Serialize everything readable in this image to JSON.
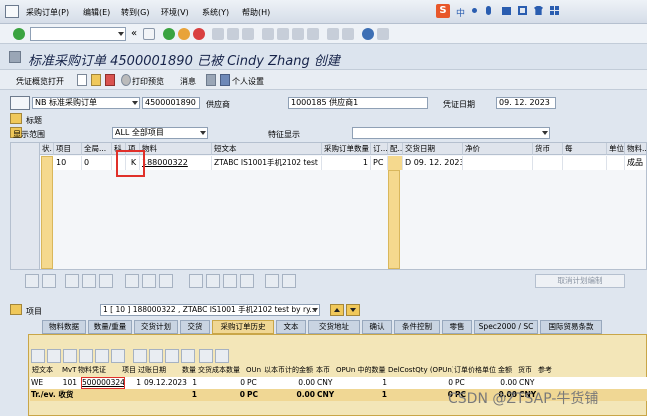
{
  "menubar": {
    "items": [
      "采购订单(P)",
      "编辑(E)",
      "转到(G)",
      "环境(V)",
      "系统(Y)",
      "帮助(H)"
    ],
    "ime_logo": "S",
    "ime_label": "中"
  },
  "toolbar": {
    "command_field": "",
    "nav_arrows": "«"
  },
  "title": "标准采购订单 4500001890 已被 Cindy Zhang 创建",
  "app_toolbar": {
    "overview_label": "凭证概览打开",
    "print_preview_label": "打印预览",
    "messages_label": "消息",
    "personal_settings_label": "个人设置"
  },
  "header": {
    "doc_type_value": "NB 标准采购订单",
    "po_number": "4500001890",
    "vendor_label": "供应商",
    "vendor_value": "1000185 供应商1",
    "doc_date_label": "凭证日期",
    "doc_date_value": "09. 12. 2023",
    "header_label": "标题",
    "display_range_label": "显示范围",
    "display_range_value": "ALL 全部项目",
    "feature_display_label": "特征显示",
    "feature_display_value": ""
  },
  "item_grid": {
    "columns": [
      "状.",
      "项目",
      "全局...",
      "科",
      "项.",
      "物料",
      "短文本",
      "采购订单数量",
      "订...",
      "配..",
      "交货日期",
      "净价",
      "货币",
      "每",
      "单位",
      "物料..."
    ],
    "rows": [
      {
        "item": "10",
        "global": "0",
        "acct": "",
        "cat": "K",
        "material": "188000322",
        "short_text": "ZTABC IS1001手机2102 test ...",
        "qty": "1",
        "unit": "PC",
        "d": "D",
        "delivery_date": "09. 12. 2023",
        "net_price": "",
        "currency": "",
        "per": "",
        "uom": "",
        "mat_group": "成品"
      }
    ]
  },
  "grid_footer": {
    "proposal_button": "取消计划编制"
  },
  "item_bar": {
    "label": "项目",
    "value": "1 [ 10 ] 188000322 , ZTABC IS1001 手机2102 test by ry..."
  },
  "detail_tabs": [
    "物料数据",
    "数量/重量",
    "交货计划",
    "交货",
    "采购订单历史",
    "文本",
    "交货地址",
    "确认",
    "条件控制",
    "零售",
    "Spec2000 / SC",
    "国际贸易条款"
  ],
  "active_tab": "采购订单历史",
  "history": {
    "columns": [
      "短文本",
      "MvT",
      "物料凭证",
      "项目",
      "过账日期",
      "数量",
      "交货成本数量",
      "OUn",
      "以本币计的金额",
      "本币",
      "OPUn 中的数量",
      "DelCostQty (OPUn)",
      "订单价格单位",
      "金额",
      "货币",
      "参考"
    ],
    "rows": [
      {
        "short_text": "WE",
        "mvt": "101",
        "mat_doc": "5000003245",
        "item": "1",
        "posting_date": "09.12.2023",
        "qty": "1",
        "dc_qty": "0",
        "oun": "PC",
        "amount_lc": "0.00",
        "lc": "CNY",
        "qty_opun": "1",
        "delcost_opun": "0",
        "opu": "PC",
        "amount": "0.00",
        "curr": "CNY",
        "ref": ""
      },
      {
        "short_text": "Tr./ev. 收货",
        "mvt": "",
        "mat_doc": "",
        "item": "",
        "posting_date": "",
        "qty": "1",
        "dc_qty": "0",
        "oun": "PC",
        "amount_lc": "0.00",
        "lc": "CNY",
        "qty_opun": "1",
        "delcost_opun": "0",
        "opu": "PC",
        "amount": "0.00",
        "curr": "CNY",
        "ref": ""
      }
    ]
  },
  "watermark": "CSDN @ZTSAP-牛货铺",
  "colors": {
    "accent_yellow": "#f0d794",
    "highlight_red": "#e0302a",
    "header_blue": "#17244a"
  }
}
